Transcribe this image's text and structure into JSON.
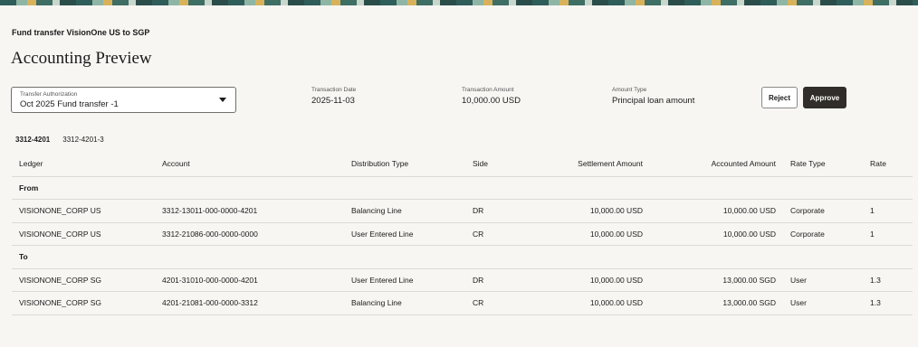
{
  "header": {
    "subtitle": "Fund transfer VisionOne US to SGP",
    "title": "Accounting Preview"
  },
  "transfer_select": {
    "label": "Transfer Authorization",
    "value": "Oct 2025 Fund transfer -1"
  },
  "info": {
    "transaction_date": {
      "label": "Transaction Date",
      "value": "2025-11-03"
    },
    "transaction_amount": {
      "label": "Transaction Amount",
      "value": "10,000.00 USD"
    },
    "amount_type": {
      "label": "Amount Type",
      "value": "Principal loan amount"
    }
  },
  "actions": {
    "reject": "Reject",
    "approve": "Approve"
  },
  "tabs": [
    {
      "label": "3312-4201",
      "active": true
    },
    {
      "label": "3312-4201-3",
      "active": false
    }
  ],
  "table": {
    "columns": [
      "Ledger",
      "Account",
      "Distribution Type",
      "Side",
      "Settlement Amount",
      "Accounted Amount",
      "Rate Type",
      "Rate"
    ],
    "groups": [
      {
        "label": "From",
        "rows": [
          [
            "VISIONONE_CORP US",
            "3312-13011-000-0000-4201",
            "Balancing Line",
            "DR",
            "10,000.00 USD",
            "10,000.00 USD",
            "Corporate",
            "1"
          ],
          [
            "VISIONONE_CORP US",
            "3312-21086-000-0000-0000",
            "User Entered Line",
            "CR",
            "10,000.00 USD",
            "10,000.00 USD",
            "Corporate",
            "1"
          ]
        ]
      },
      {
        "label": "To",
        "rows": [
          [
            "VISIONONE_CORP SG",
            "4201-31010-000-0000-4201",
            "User Entered Line",
            "DR",
            "10,000.00 USD",
            "13,000.00 SGD",
            "User",
            "1.3"
          ],
          [
            "VISIONONE_CORP SG",
            "4201-21081-000-0000-3312",
            "Balancing Line",
            "CR",
            "10,000.00 USD",
            "13,000.00 SGD",
            "User",
            "1.3"
          ]
        ]
      }
    ]
  }
}
